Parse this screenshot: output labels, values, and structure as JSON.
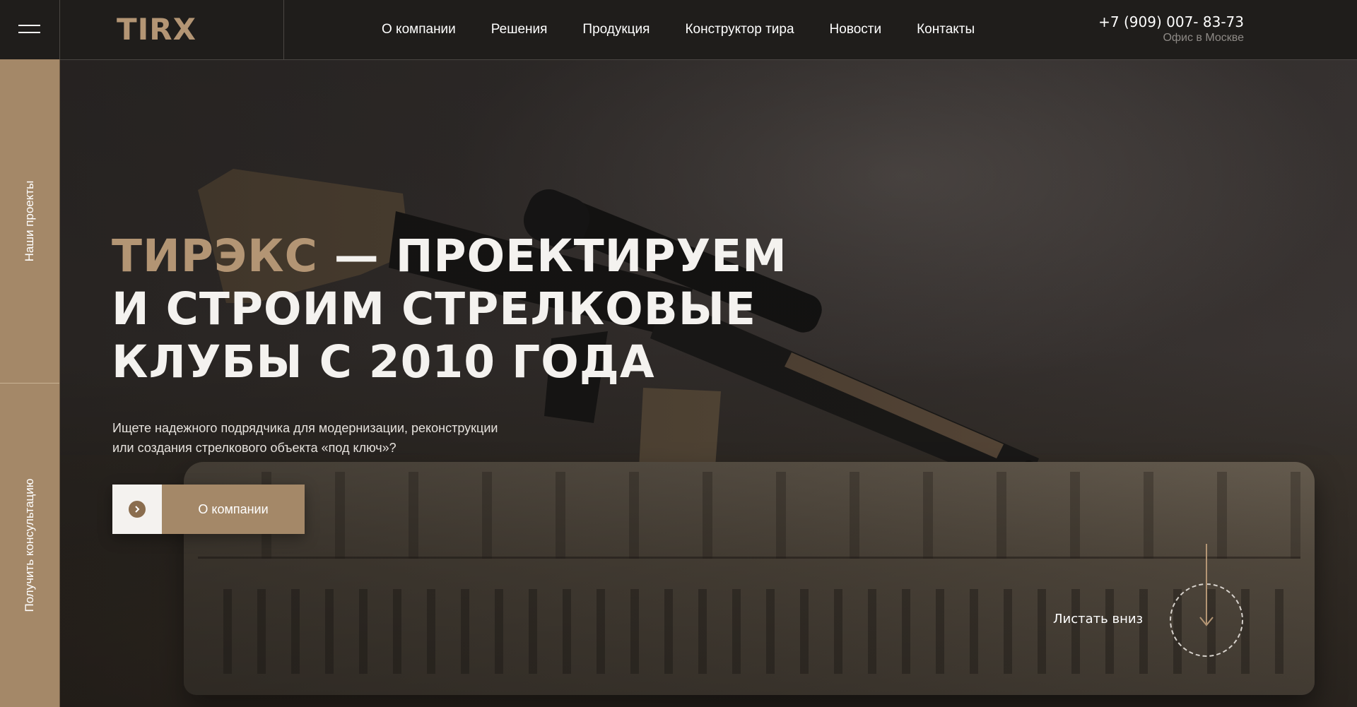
{
  "header": {
    "logo_text": "TIRX",
    "nav": [
      {
        "label": "О компании"
      },
      {
        "label": "Решения"
      },
      {
        "label": "Продукция"
      },
      {
        "label": "Конструктор тира"
      },
      {
        "label": "Новости"
      },
      {
        "label": "Контакты"
      }
    ],
    "phone": "+7 (909) 007- 83-73",
    "office": "Офис в Москве"
  },
  "sidebar": {
    "items": [
      {
        "label": "Наши проекты"
      },
      {
        "label": "Получить консультацию"
      }
    ]
  },
  "hero": {
    "headline_accent": "ТИРЭКС",
    "headline_line1_rest": " — ПРОЕКТИРУЕМ",
    "headline_line2": "И СТРОИМ СТРЕЛКОВЫЕ",
    "headline_line3": "КЛУБЫ С 2010 ГОДА",
    "subtitle_line1": "Ищете надежного подрядчика для модернизации, реконструкции",
    "subtitle_line2": "или создания стрелкового объекта «под ключ»?",
    "cta_label": "О компании",
    "scroll_label": "Листать вниз"
  },
  "colors": {
    "accent": "#a48868",
    "accent_text": "#b39574",
    "topbar_bg": "#1f1d1b"
  },
  "icons": [
    "menu-icon",
    "chevron-right-icon",
    "arrow-down-icon"
  ]
}
